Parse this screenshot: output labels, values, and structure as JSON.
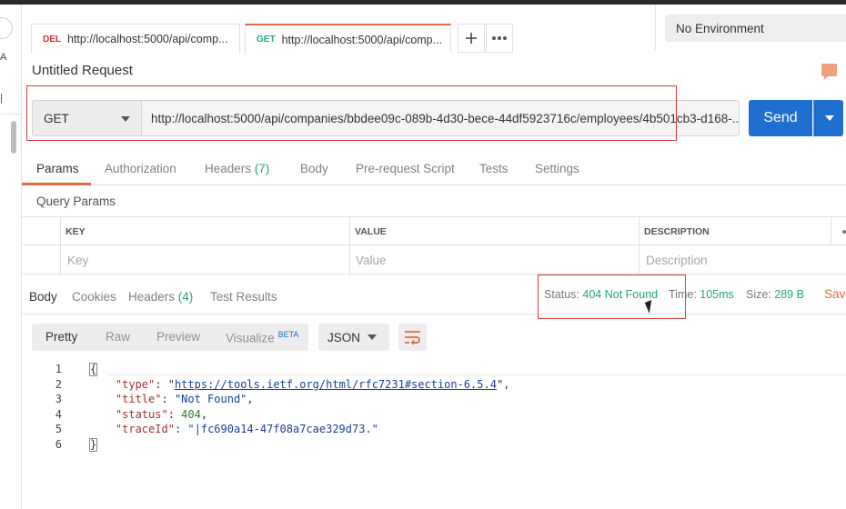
{
  "tabs": [
    {
      "method": "DEL",
      "method_color": "#cc3333",
      "url": "http://localhost:5000/api/comp..."
    },
    {
      "method": "GET",
      "method_color": "#26a672",
      "url": "http://localhost:5000/api/comp..."
    }
  ],
  "tab_actions": {
    "add_icon": "plus-icon",
    "more_icon": "more-horizontal-icon"
  },
  "environment": {
    "selected": "No Environment"
  },
  "request": {
    "title": "Untitled Request",
    "method": "GET",
    "url": "http://localhost:5000/api/companies/bbdee09c-089b-4d30-bece-44df5923716c/employees/4b501cb3-d168-...",
    "send_label": "Send"
  },
  "request_tabs": {
    "params": "Params",
    "authorization": "Authorization",
    "headers": "Headers",
    "headers_count": "(7)",
    "body": "Body",
    "prerequest": "Pre-request Script",
    "tests": "Tests",
    "settings": "Settings"
  },
  "query_params": {
    "label": "Query Params",
    "columns": [
      "KEY",
      "VALUE",
      "DESCRIPTION"
    ],
    "placeholders": [
      "Key",
      "Value",
      "Description"
    ]
  },
  "response_tabs": {
    "body": "Body",
    "cookies": "Cookies",
    "headers": "Headers",
    "headers_count": "(4)",
    "test_results": "Test Results"
  },
  "response_meta": {
    "status_label": "Status:",
    "status_value": "404 Not Found",
    "time_label": "Time:",
    "time_value": "105ms",
    "size_label": "Size:",
    "size_value": "289 B",
    "save_label": "Save"
  },
  "format": {
    "modes": [
      "Pretty",
      "Raw",
      "Preview",
      "Visualize"
    ],
    "beta_badge": "BETA",
    "language": "JSON"
  },
  "response_body": {
    "line_numbers": [
      "1",
      "2",
      "3",
      "4",
      "5",
      "6"
    ],
    "open_brace": "{",
    "close_brace": "}",
    "type_key": "\"type\"",
    "type_value": "https://tools.ietf.org/html/rfc7231#section-6.5.4",
    "title_key": "\"title\"",
    "title_value": "\"Not Found\"",
    "status_key": "\"status\"",
    "status_value": "404",
    "traceid_key": "\"traceId\"",
    "traceid_value": "\"|fc690a14-47f08a7cae329d73.\""
  },
  "colors": {
    "accent_orange": "#e06b3d",
    "send_blue": "#1f6fd0",
    "status_green": "#26a672",
    "highlight_red": "#d63b3b"
  }
}
